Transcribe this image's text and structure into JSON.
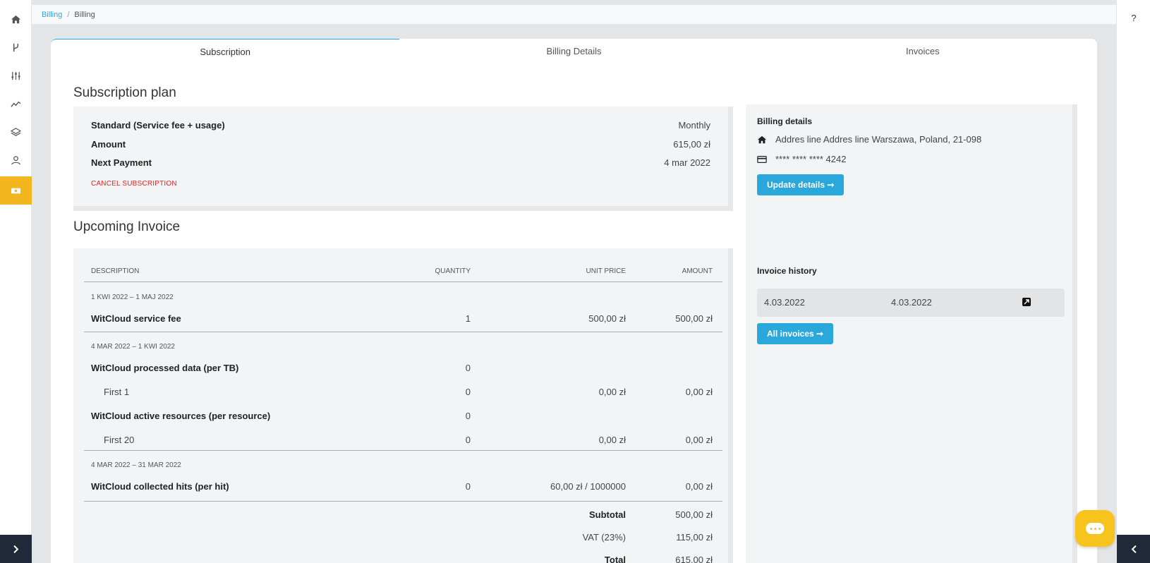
{
  "breadcrumb": {
    "root": "Billing",
    "separator": "/",
    "current": "Billing"
  },
  "nav": {
    "icons": [
      "home-icon",
      "branch-icon",
      "sliders-icon",
      "chart-line-icon",
      "layers-icon",
      "user-icon",
      "billing-icon"
    ],
    "active": "billing-icon"
  },
  "help": "?",
  "tabs": [
    {
      "label": "Subscription",
      "active": true
    },
    {
      "label": "Billing Details",
      "active": false
    },
    {
      "label": "Invoices",
      "active": false
    }
  ],
  "plan": {
    "title": "Subscription plan",
    "rows": [
      {
        "label": "Standard (Service fee + usage)",
        "value": "Monthly"
      },
      {
        "label": "Amount",
        "value": "615,00 zł"
      },
      {
        "label": "Next Payment",
        "value": "4 mar 2022"
      }
    ],
    "cancel": "CANCEL SUBSCRIPTION"
  },
  "invoice": {
    "title": "Upcoming Invoice",
    "headers": {
      "description": "DESCRIPTION",
      "quantity": "QUANTITY",
      "unit_price": "UNIT PRICE",
      "amount": "AMOUNT"
    },
    "groups": [
      {
        "period": "1 KWI 2022 – 1 MAJ 2022",
        "items": [
          {
            "description": "WitCloud service fee",
            "quantity": "1",
            "unit_price": "500,00 zł",
            "amount": "500,00 zł",
            "bold": true
          }
        ]
      },
      {
        "period": "4 MAR 2022 – 1 KWI 2022",
        "items": [
          {
            "description": "WitCloud processed data (per TB)",
            "quantity": "0",
            "unit_price": "",
            "amount": "",
            "bold": true
          },
          {
            "description": "First 1",
            "quantity": "0",
            "unit_price": "0,00 zł",
            "amount": "0,00 zł",
            "bold": false
          },
          {
            "description": "WitCloud active resources (per resource)",
            "quantity": "0",
            "unit_price": "",
            "amount": "",
            "bold": true
          },
          {
            "description": "First 20",
            "quantity": "0",
            "unit_price": "0,00 zł",
            "amount": "0,00 zł",
            "bold": false
          }
        ]
      },
      {
        "period": "4 MAR 2022 – 31 MAR 2022",
        "items": [
          {
            "description": "WitCloud collected hits (per hit)",
            "quantity": "0",
            "unit_price": "60,00 zł / 1000000",
            "amount": "0,00 zł",
            "bold": true
          }
        ]
      }
    ],
    "totals": [
      {
        "label": "Subtotal",
        "value": "500,00 zł",
        "bold": true
      },
      {
        "label": "VAT (23%)",
        "value": "115,00 zł",
        "bold": false
      },
      {
        "label": "Total",
        "value": "615,00 zł",
        "bold": true
      }
    ]
  },
  "billing_details": {
    "title": "Billing details",
    "address": "Addres line Addres line Warszawa, Poland, 21-098",
    "card": "**** **** **** 4242",
    "update_button": "Update details ➞"
  },
  "invoice_history": {
    "title": "Invoice history",
    "rows": [
      {
        "date": "4.03.2022",
        "due": "4.03.2022"
      }
    ],
    "all_button": "All invoices ➞"
  }
}
